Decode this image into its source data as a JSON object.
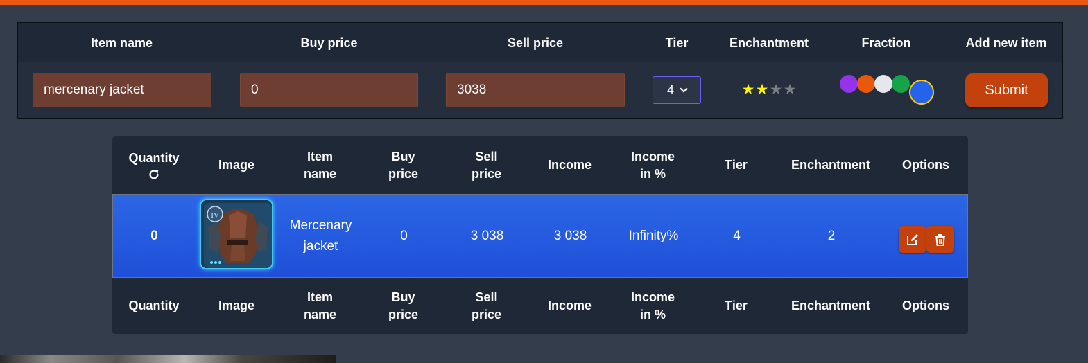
{
  "colors": {
    "accent": "#ea580c",
    "button": "#c2410c",
    "row_highlight": "#2563eb",
    "input_bg": "#6f3e33",
    "page_bg": "#333d4c",
    "header_bg": "#1f2837"
  },
  "form": {
    "headers": [
      "Item name",
      "Buy price",
      "Sell price",
      "Tier",
      "Enchantment",
      "Fraction",
      "Add new item"
    ],
    "item_name_value": "mercenary jacket",
    "buy_price_value": "0",
    "sell_price_value": "3038",
    "tier_selected": "4",
    "enchantment_level": 2,
    "enchantment_max": 4,
    "fraction_options": [
      "purple",
      "orange",
      "white",
      "green",
      "blue"
    ],
    "fraction_selected": "blue",
    "submit_label": "Submit"
  },
  "table": {
    "headers": [
      [
        "Quantity"
      ],
      [
        "Image"
      ],
      [
        "Item",
        "name"
      ],
      [
        "Buy",
        "price"
      ],
      [
        "Sell",
        "price"
      ],
      [
        "Income"
      ],
      [
        "Income",
        "in %"
      ],
      [
        "Tier"
      ],
      [
        "Enchantment"
      ],
      [
        "Options"
      ]
    ],
    "refresh_icon": "refresh-icon",
    "rows": [
      {
        "quantity": "0",
        "image_icon": "mercenary-jacket-image",
        "image_tier_badge": "IV",
        "item_name": [
          "Mercenary",
          "jacket"
        ],
        "buy_price": "0",
        "sell_price": "3 038",
        "income": "3 038",
        "income_percent": "Infinity%",
        "tier": "4",
        "enchantment": "2",
        "options": [
          "edit-icon",
          "trash-icon"
        ]
      }
    ]
  }
}
